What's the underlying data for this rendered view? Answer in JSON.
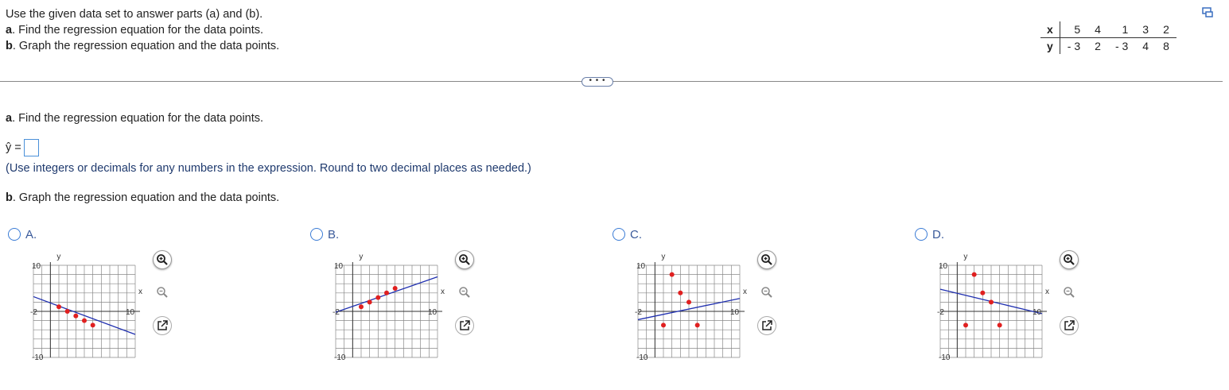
{
  "intro": {
    "line1": "Use the given data set to answer parts (a) and (b).",
    "line2_label": "a",
    "line2_text": ". Find the regression equation for the data points.",
    "line3_label": "b",
    "line3_text": ". Graph the regression equation and the data points."
  },
  "data_table": {
    "x_label": "x",
    "y_label": "y",
    "x": [
      "5",
      "4",
      "1",
      "3",
      "2"
    ],
    "y": [
      "- 3",
      "2",
      "- 3",
      "4",
      "8"
    ]
  },
  "expander": "• • •",
  "part_a": {
    "label": "a",
    "text": ". Find the regression equation for the data points.",
    "yhat": "ŷ =",
    "instruction": "(Use integers or decimals for any numbers in the expression. Round to two decimal places as needed.)"
  },
  "part_b": {
    "label": "b",
    "text": ". Graph the regression equation and the data points."
  },
  "options": [
    {
      "label": "A."
    },
    {
      "label": "B."
    },
    {
      "label": "C."
    },
    {
      "label": "D."
    }
  ],
  "graph_labels": {
    "y": "y",
    "x": "x",
    "ten": "10",
    "neg_ten": "-10",
    "neg_two": "-2"
  },
  "colors": {
    "point": "#e02020",
    "line": "#2030b0",
    "grid": "#888888",
    "accent": "#3a7bd5"
  }
}
